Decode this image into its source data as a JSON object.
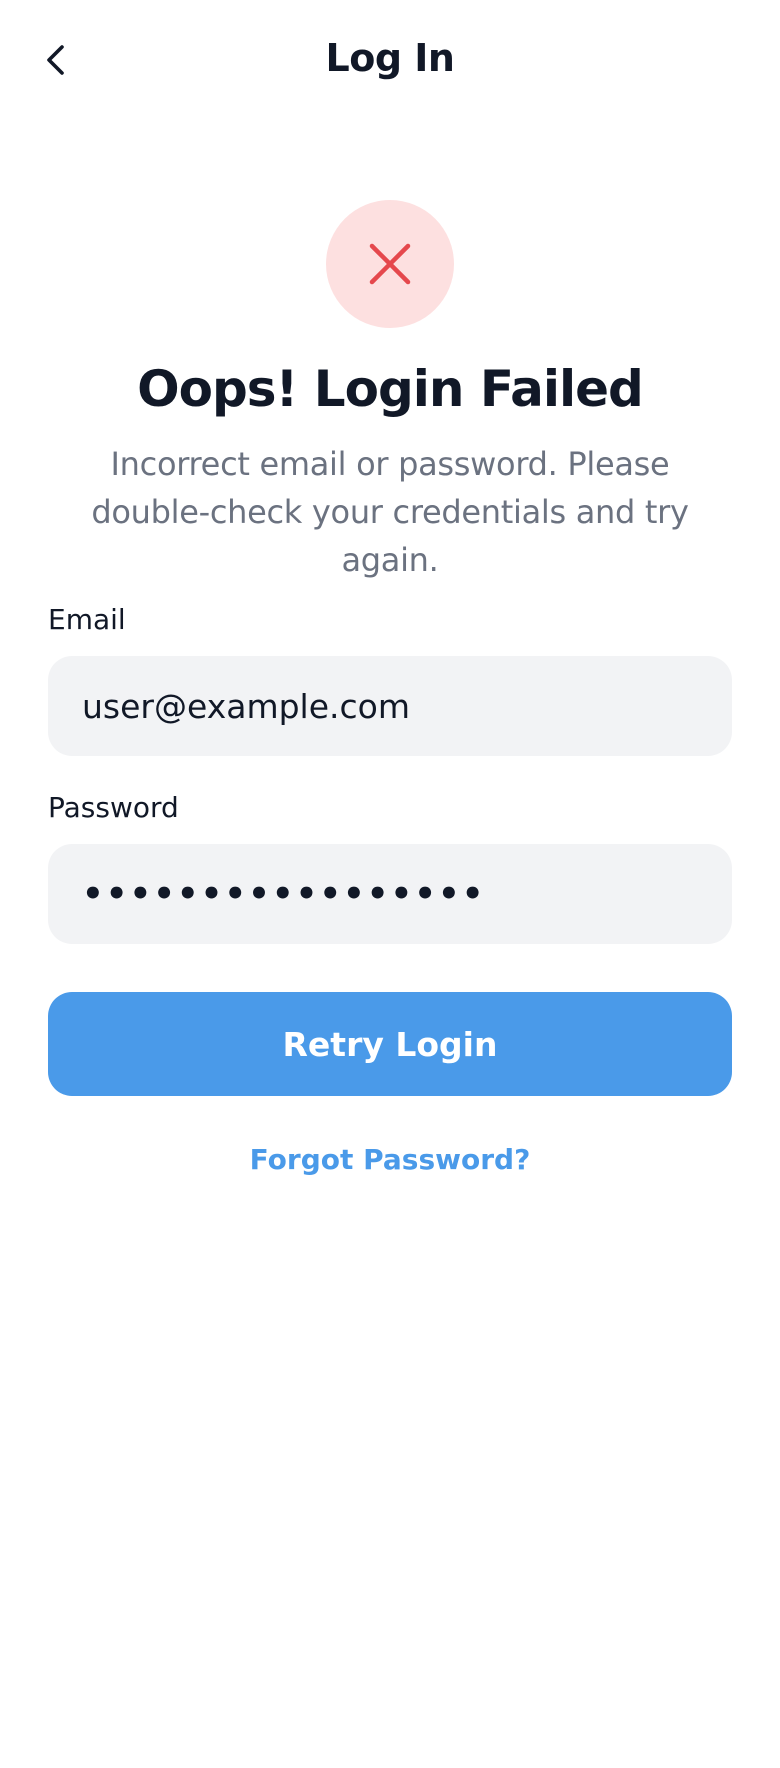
{
  "header": {
    "title": "Log In",
    "back_icon": "chevron-left-icon"
  },
  "status": {
    "icon": "close-icon",
    "icon_color": "#e5484d",
    "circle_color": "#fde0e0",
    "headline": "Oops! Login Failed",
    "message": "Incorrect email or password. Please double-check your credentials and try again."
  },
  "form": {
    "email_label": "Email",
    "email_value": "user@example.com",
    "password_label": "Password",
    "password_value": "•••••••••••••••••",
    "retry_label": "Retry Login",
    "forgot_label": "Forgot Password?"
  },
  "colors": {
    "accent": "#4a9ae9",
    "field_bg": "#f2f3f5",
    "text_primary": "#111827",
    "text_secondary": "#6b7280"
  }
}
